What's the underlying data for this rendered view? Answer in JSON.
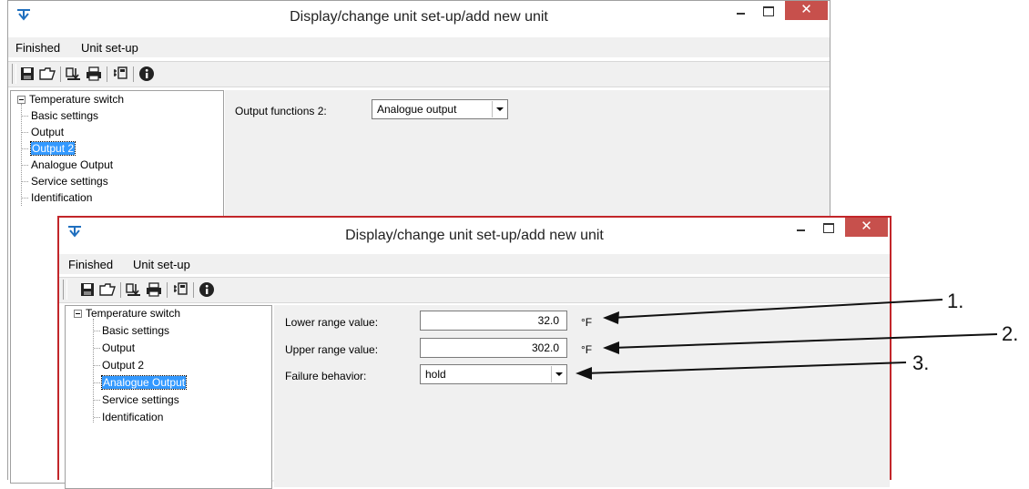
{
  "background_window": {
    "title": "Display/change unit set-up/add new unit",
    "menu": [
      "Finished",
      "Unit set-up"
    ],
    "tree": {
      "root": "Temperature switch",
      "items": [
        "Basic settings",
        "Output",
        "Output 2",
        "Analogue Output",
        "Service settings",
        "Identification"
      ],
      "selected": "Output 2"
    },
    "form": {
      "output_functions_label": "Output functions 2:",
      "output_functions_value": "Analogue output"
    }
  },
  "foreground_window": {
    "title": "Display/change unit set-up/add new unit",
    "menu": [
      "Finished",
      "Unit set-up"
    ],
    "tree": {
      "root": "Temperature switch",
      "items": [
        "Basic settings",
        "Output",
        "Output 2",
        "Analogue Output",
        "Service settings",
        "Identification"
      ],
      "selected": "Analogue Output"
    },
    "form": {
      "lower_label": "Lower range value:",
      "lower_value": "32.0",
      "lower_unit": "°F",
      "upper_label": "Upper range value:",
      "upper_value": "302.0",
      "upper_unit": "°F",
      "failure_label": "Failure behavior:",
      "failure_value": "hold"
    }
  },
  "toolbar_icons": [
    "save-icon",
    "open-folder-icon",
    "download-icon",
    "print-icon",
    "connect-icon",
    "info-icon"
  ],
  "window_buttons": {
    "close": "✕"
  },
  "callouts": [
    "1.",
    "2.",
    "3."
  ],
  "colors": {
    "highlight_border": "#c2262a",
    "selection": "#3399ff",
    "close_button": "#c7504c"
  }
}
